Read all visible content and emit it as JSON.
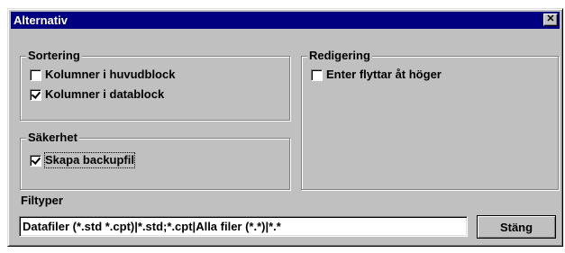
{
  "window": {
    "title": "Alternativ",
    "close_symbol": "✕"
  },
  "sorting": {
    "label": "Sortering",
    "items": [
      {
        "label": "Kolumner i huvudblock",
        "checked": false
      },
      {
        "label": "Kolumner i datablock",
        "checked": true
      }
    ]
  },
  "security": {
    "label": "Säkerhet",
    "items": [
      {
        "label": "Skapa backupfil",
        "checked": true
      }
    ]
  },
  "editing": {
    "label": "Redigering",
    "items": [
      {
        "label": "Enter flyttar åt höger",
        "checked": false
      }
    ]
  },
  "filetypes": {
    "label": "Filtyper",
    "value": "Datafiler (*.std *.cpt)|*.std;*.cpt|Alla filer (*.*)|*.*"
  },
  "buttons": {
    "close_label": "Stäng"
  },
  "colors": {
    "titlebar": "#000080",
    "face": "#c0c0c0"
  }
}
